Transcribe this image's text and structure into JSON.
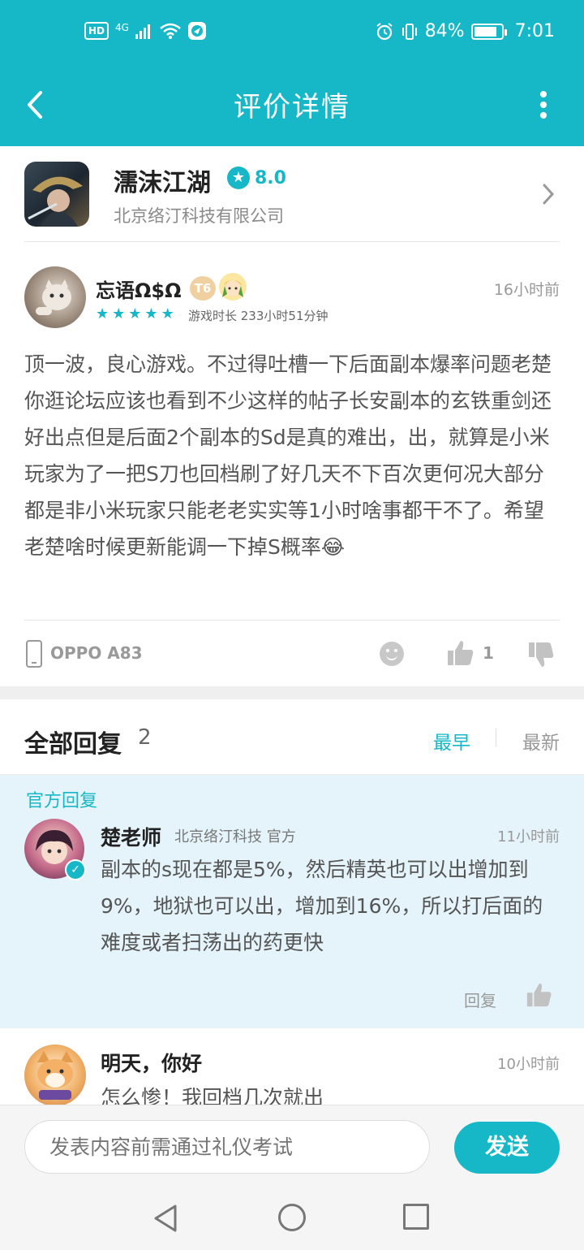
{
  "status_bar": {
    "hd": "HD",
    "network": "4G",
    "battery_percent": "84%",
    "battery_level": 0.84,
    "time": "7:01"
  },
  "header": {
    "title": "评价详情",
    "back_icon": "chevron-left-icon",
    "more_icon": "more-vertical-icon",
    "color": "#16b8c7"
  },
  "game": {
    "name": "濡沫江湖",
    "rating": "8.0",
    "developer": "北京络汀科技有限公司"
  },
  "review": {
    "author": "忘语Ω$Ω",
    "level_badge": "T6",
    "time": "16小时前",
    "star_count": 5,
    "playtime": "游戏时长 233小时51分钟",
    "content": "顶一波，良心游戏。不过得吐槽一下后面副本爆率问题老楚你逛论坛应该也看到不少这样的帖子长安副本的玄铁重剑还好出点但是后面2个副本的Sd是真的难出，出，就算是小米玩家为了一把S刀也回档刷了好几天不下百次更何况大部分都是非小米玩家只能老老实实等1小时啥事都干不了。希望老楚啥时候更新能调一下掉S概率😂",
    "device": "OPPO A83",
    "likes": "1"
  },
  "replies": {
    "title": "全部回复",
    "count": "2",
    "sort_earliest": "最早",
    "sort_latest": "最新",
    "official": {
      "label": "官方回复",
      "author": "楚老师",
      "org": "北京络汀科技 官方",
      "time": "11小时前",
      "content": "副本的s现在都是5%，然后精英也可以出增加到9%，地狱也可以出，增加到16%，所以打后面的难度或者扫荡出的药更快",
      "reply_label": "回复"
    },
    "items": [
      {
        "author": "明天，你好",
        "time": "10小时前",
        "content": "怎么惨！我回档几次就出"
      }
    ]
  },
  "composer": {
    "placeholder": "发表内容前需通过礼仪考试",
    "send_label": "发送"
  }
}
